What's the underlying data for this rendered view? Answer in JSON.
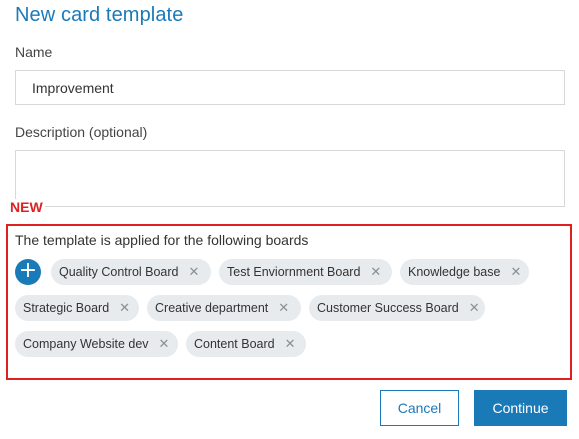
{
  "dialog": {
    "title": "New card template"
  },
  "name_field": {
    "label": "Name",
    "value": "Improvement"
  },
  "description_field": {
    "label": "Description (optional)",
    "value": ""
  },
  "new_badge": "NEW",
  "boards": {
    "label": "The template is applied for the following boards",
    "add_icon": "plus-icon",
    "add_symbol": "+",
    "remove_symbol": "✕",
    "items": [
      "Quality Control Board",
      "Test Enviornment Board",
      "Knowledge base",
      "Strategic Board",
      "Creative department",
      "Customer Success Board",
      "Company Website dev",
      "Content Board"
    ]
  },
  "footer": {
    "cancel_label": "Cancel",
    "continue_label": "Continue"
  },
  "colors": {
    "accent": "#1a7ab8",
    "highlight": "#e02020",
    "chip_bg": "#e8ebee"
  }
}
